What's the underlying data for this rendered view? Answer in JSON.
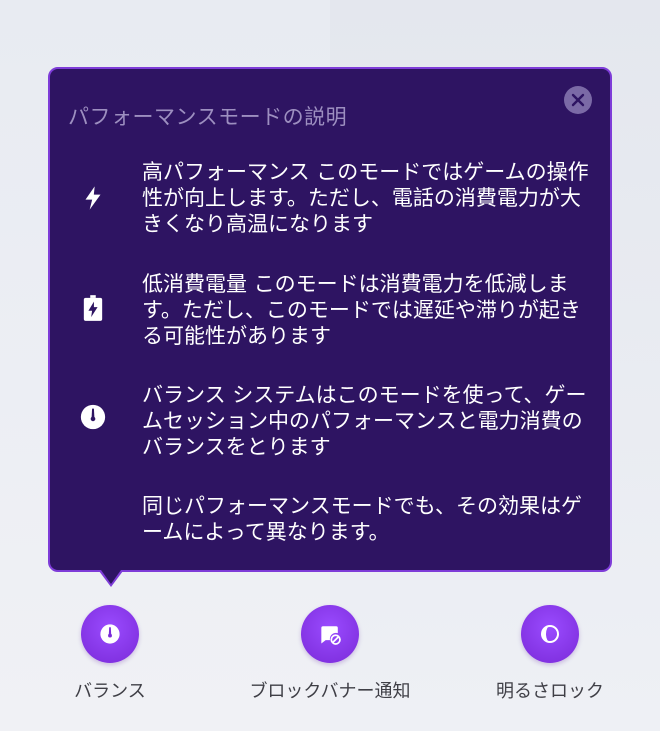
{
  "popover": {
    "title": "パフォーマンスモードの説明",
    "close_icon": "close-icon",
    "rows": [
      {
        "icon": "lightning-icon",
        "text": "高パフォーマンス このモードではゲームの操作性が向上します。ただし、電話の消費電力が大きくなり高温になります"
      },
      {
        "icon": "battery-saver-icon",
        "text": "低消費電量 このモードは消費電力を低減します。ただし、このモードでは遅延や滞りが起きる可能性があります"
      },
      {
        "icon": "gauge-icon",
        "text": "バランス システムはこのモードを使って、ゲームセッション中のパフォーマンスと電力消費のバランスをとります"
      },
      {
        "icon": "",
        "text": "同じパフォーマンスモードでも、その効果はゲームによって異なります。"
      }
    ]
  },
  "modes": [
    {
      "label": "バランス",
      "icon": "gauge-icon"
    },
    {
      "label": "ブロックバナー通知",
      "icon": "block-notification-icon"
    },
    {
      "label": "明るさロック",
      "icon": "brightness-lock-icon"
    }
  ],
  "colors": {
    "popover_bg": "#2e1462",
    "popover_border": "#7e3cd8",
    "accent": "#7a2ad8"
  }
}
